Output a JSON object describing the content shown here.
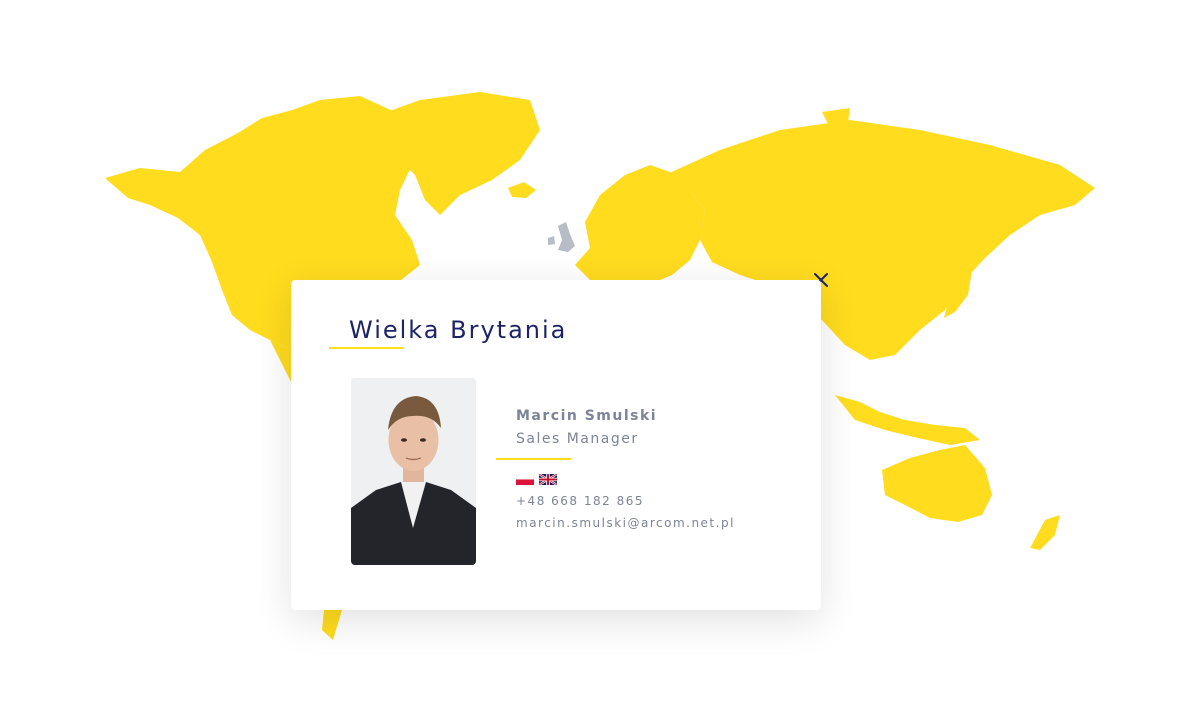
{
  "map": {
    "highlight_color": "#FFDC1E",
    "selected_country_color": "#B7BCC7",
    "selected_country": "united-kingdom"
  },
  "popup": {
    "title": "Wielka Brytania",
    "close_icon": "close-icon",
    "contact": {
      "name": "Marcin Smulski",
      "role": "Sales Manager",
      "languages": [
        "Polish flag",
        "UK flag"
      ],
      "phone": "+48 668 182 865",
      "email": "marcin.smulski@arcom.net.pl"
    }
  },
  "colors": {
    "accent": "#FFDC1E",
    "title": "#1C2466",
    "text": "#7D8499"
  }
}
